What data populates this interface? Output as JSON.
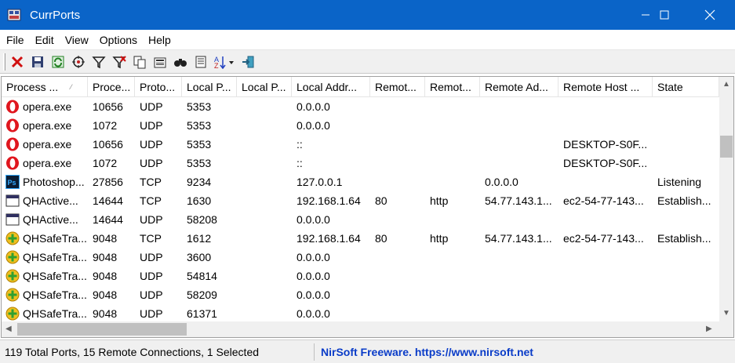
{
  "window": {
    "title": "CurrPorts",
    "minimize_glyph": "—",
    "maximize_glyph": "☐",
    "close_glyph": "✕"
  },
  "menu": [
    "File",
    "Edit",
    "View",
    "Options",
    "Help"
  ],
  "toolbar": {
    "buttons": [
      "close-connection-icon",
      "save-icon",
      "refresh-icon",
      "properties-target-icon",
      "filter-icon",
      "advanced-filter-icon",
      "copy-icon",
      "html-report-icon",
      "find-binoculars-icon",
      "report-page-icon",
      "sort-az-icon",
      "exit-icon"
    ]
  },
  "columns": [
    "Process ...",
    "Proce...",
    "Proto...",
    "Local P...",
    "Local P...",
    "Local Addr...",
    "Remot...",
    "Remot...",
    "Remote Ad...",
    "Remote Host ...",
    "State"
  ],
  "rows": [
    {
      "icon": "opera",
      "cells": [
        "opera.exe",
        "10656",
        "UDP",
        "5353",
        "",
        "0.0.0.0",
        "",
        "",
        "",
        "",
        ""
      ]
    },
    {
      "icon": "opera",
      "cells": [
        "opera.exe",
        "1072",
        "UDP",
        "5353",
        "",
        "0.0.0.0",
        "",
        "",
        "",
        "",
        ""
      ]
    },
    {
      "icon": "opera",
      "cells": [
        "opera.exe",
        "10656",
        "UDP",
        "5353",
        "",
        "::",
        "",
        "",
        "",
        "DESKTOP-S0F...",
        ""
      ]
    },
    {
      "icon": "opera",
      "cells": [
        "opera.exe",
        "1072",
        "UDP",
        "5353",
        "",
        "::",
        "",
        "",
        "",
        "DESKTOP-S0F...",
        ""
      ]
    },
    {
      "icon": "photoshop",
      "cells": [
        "Photoshop...",
        "27856",
        "TCP",
        "9234",
        "",
        "127.0.0.1",
        "",
        "",
        "0.0.0.0",
        "",
        "Listening"
      ]
    },
    {
      "icon": "window",
      "cells": [
        "QHActive...",
        "14644",
        "TCP",
        "1630",
        "",
        "192.168.1.64",
        "80",
        "http",
        "54.77.143.1...",
        "ec2-54-77-143...",
        "Establish..."
      ]
    },
    {
      "icon": "window",
      "cells": [
        "QHActive...",
        "14644",
        "UDP",
        "58208",
        "",
        "0.0.0.0",
        "",
        "",
        "",
        "",
        ""
      ]
    },
    {
      "icon": "safe",
      "cells": [
        "QHSafeTra...",
        "9048",
        "TCP",
        "1612",
        "",
        "192.168.1.64",
        "80",
        "http",
        "54.77.143.1...",
        "ec2-54-77-143...",
        "Establish..."
      ]
    },
    {
      "icon": "safe",
      "cells": [
        "QHSafeTra...",
        "9048",
        "UDP",
        "3600",
        "",
        "0.0.0.0",
        "",
        "",
        "",
        "",
        ""
      ]
    },
    {
      "icon": "safe",
      "cells": [
        "QHSafeTra...",
        "9048",
        "UDP",
        "54814",
        "",
        "0.0.0.0",
        "",
        "",
        "",
        "",
        ""
      ]
    },
    {
      "icon": "safe",
      "cells": [
        "QHSafeTra...",
        "9048",
        "UDP",
        "58209",
        "",
        "0.0.0.0",
        "",
        "",
        "",
        "",
        ""
      ]
    },
    {
      "icon": "safe",
      "cells": [
        "QHSafeTra...",
        "9048",
        "UDP",
        "61371",
        "",
        "0.0.0.0",
        "",
        "",
        "",
        "",
        ""
      ]
    }
  ],
  "status": {
    "summary": "119 Total Ports, 15 Remote Connections, 1 Selected",
    "link": "NirSoft Freeware. https://www.nirsoft.net"
  }
}
